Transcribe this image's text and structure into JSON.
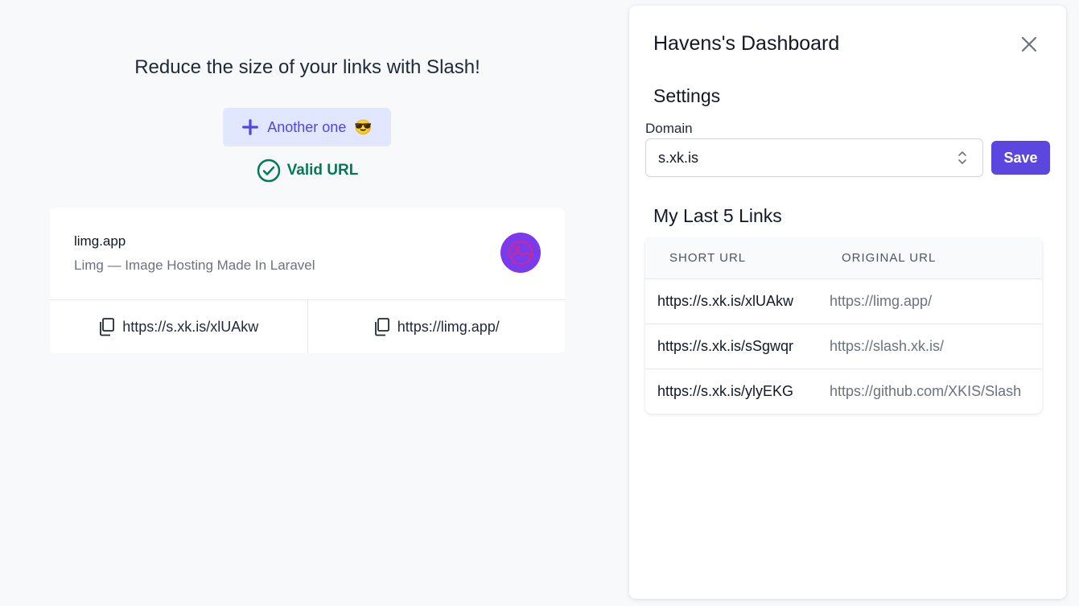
{
  "main": {
    "headline": "Reduce the size of your links with Slash!",
    "another_button": {
      "label": "Another one",
      "emoji": "😎"
    },
    "validation": {
      "text": "Valid URL",
      "color": "#047857"
    },
    "result_card": {
      "domain": "limg.app",
      "description": "Limg — Image Hosting Made In Laravel",
      "short_url": "https://s.xk.is/xlUAkw",
      "original_url": "https://limg.app/",
      "avatar_icon": "image-icon"
    }
  },
  "dashboard": {
    "title": "Havens's Dashboard",
    "settings_heading": "Settings",
    "domain_label": "Domain",
    "domain_value": "s.xk.is",
    "save_label": "Save",
    "links_heading": "My Last 5 Links",
    "columns": [
      "SHORT URL",
      "ORIGINAL URL"
    ],
    "links": [
      {
        "short": "https://s.xk.is/xlUAkw",
        "original": "https://limg.app/"
      },
      {
        "short": "https://s.xk.is/sSgwqr",
        "original": "https://slash.xk.is/"
      },
      {
        "short": "https://s.xk.is/ylyEKG",
        "original": "https://github.com/XKIS/Slash"
      }
    ]
  },
  "colors": {
    "accent": "#4f46e5",
    "save": "#5b47e0",
    "success": "#047857"
  }
}
